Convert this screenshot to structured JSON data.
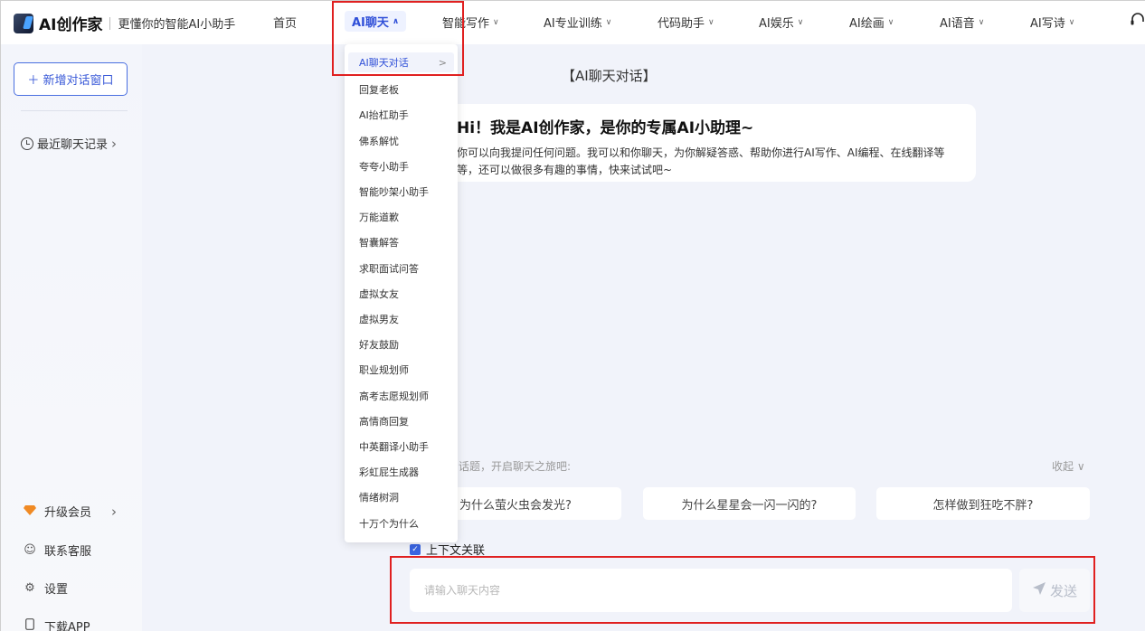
{
  "logo": {
    "name": "AI创作家",
    "tagline": "更懂你的智能AI小助手"
  },
  "nav": {
    "items": [
      {
        "label": "首页",
        "chevron": false,
        "active": false
      },
      {
        "label": "AI聊天",
        "chevron": true,
        "active": true
      },
      {
        "label": "智能写作",
        "chevron": true,
        "active": false
      },
      {
        "label": "AI专业训练",
        "chevron": true,
        "active": false
      },
      {
        "label": "代码助手",
        "chevron": true,
        "active": false
      },
      {
        "label": "AI娱乐",
        "chevron": true,
        "active": false
      },
      {
        "label": "AI绘画",
        "chevron": true,
        "active": false
      },
      {
        "label": "AI语音",
        "chevron": true,
        "active": false
      },
      {
        "label": "AI写诗",
        "chevron": true,
        "active": false
      }
    ],
    "chevron_glyph": "∨"
  },
  "sidebar": {
    "new_chat": "＋ 新增对话窗口",
    "recent": "最近聊天记录",
    "recent_chevron": "›",
    "upgrade": "升级会员",
    "upgrade_chevron": "›",
    "support": "联系客服",
    "settings": "设置",
    "download": "下载APP"
  },
  "dropdown": {
    "selected": "AI聊天对话",
    "selected_chevron": ">",
    "items": [
      "回复老板",
      "AI抬杠助手",
      "佛系解忧",
      "夸夸小助手",
      "智能吵架小助手",
      "万能道歉",
      "智囊解答",
      "求职面试问答",
      "虚拟女友",
      "虚拟男友",
      "好友鼓励",
      "职业规划师",
      "高考志愿规划师",
      "高情商回复",
      "中英翻译小助手",
      "彩虹屁生成器",
      "情绪树洞",
      "十万个为什么"
    ]
  },
  "main": {
    "title": "【AI聊天对话】",
    "welcome_heading": "Hi！我是AI创作家，是你的专属AI小助理~",
    "welcome_line1": "你可以向我提问任何问题。我可以和你聊天，为你解疑答惑、帮助你进行AI写作、AI编程、在线翻译等",
    "welcome_line2": "等，还可以做很多有趣的事情，快来试试吧~",
    "suggest_label": "话题，开启聊天之旅吧:",
    "collapse": "收起 ∨",
    "suggestions": [
      "为什么萤火虫会发光?",
      "为什么星星会一闪一闪的?",
      "怎样做到狂吃不胖?"
    ],
    "context_label": "上下文关联",
    "context_checked": true,
    "input_placeholder": "请输入聊天内容",
    "send": "发送"
  },
  "icons": {
    "headset": "headset-icon",
    "clock": "clock-icon",
    "diamond": "diamond-icon",
    "smile": "support-icon",
    "gear": "gear-icon",
    "phone": "phone-icon",
    "send": "send-icon"
  },
  "colors": {
    "accent": "#3050d8",
    "annotation": "#e02020",
    "vip": "#f08a24"
  }
}
